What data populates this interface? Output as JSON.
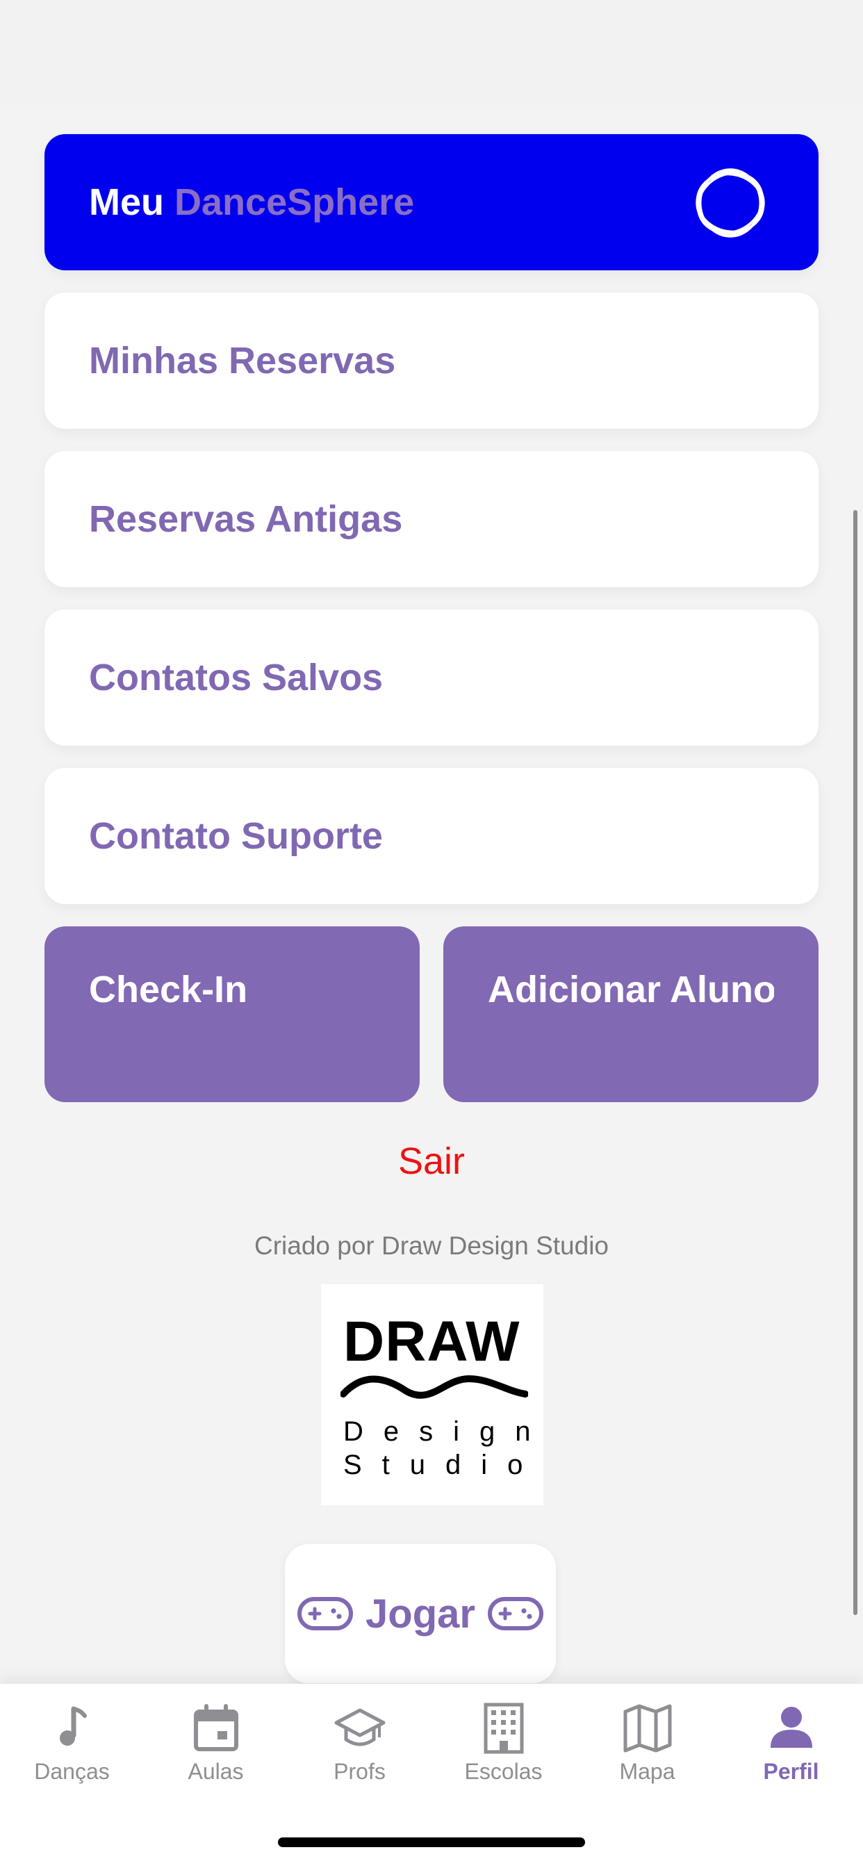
{
  "header": {
    "prefix": "Meu",
    "brand": "DanceSphere"
  },
  "menu": [
    {
      "label": "Minhas Reservas"
    },
    {
      "label": "Reservas Antigas"
    },
    {
      "label": "Contatos Salvos"
    },
    {
      "label": "Contato Suporte"
    }
  ],
  "actions": {
    "checkin": "Check-In",
    "add_student": "Adicionar Aluno"
  },
  "logout": "Sair",
  "credit": "Criado por Draw Design Studio",
  "logo": {
    "title": "DRAW",
    "line1": "Design",
    "line2": "Studio"
  },
  "play": {
    "label": "Jogar",
    "icon": "gamepad-icon"
  },
  "tabs": [
    {
      "label": "Danças",
      "icon": "music-note-icon"
    },
    {
      "label": "Aulas",
      "icon": "calendar-icon"
    },
    {
      "label": "Profs",
      "icon": "graduation-cap-icon"
    },
    {
      "label": "Escolas",
      "icon": "building-icon"
    },
    {
      "label": "Mapa",
      "icon": "map-icon"
    },
    {
      "label": "Perfil",
      "icon": "person-icon",
      "active": true
    }
  ],
  "colors": {
    "accent": "#8068b2",
    "header_bg": "#0000ee",
    "logout": "#ee1111"
  }
}
